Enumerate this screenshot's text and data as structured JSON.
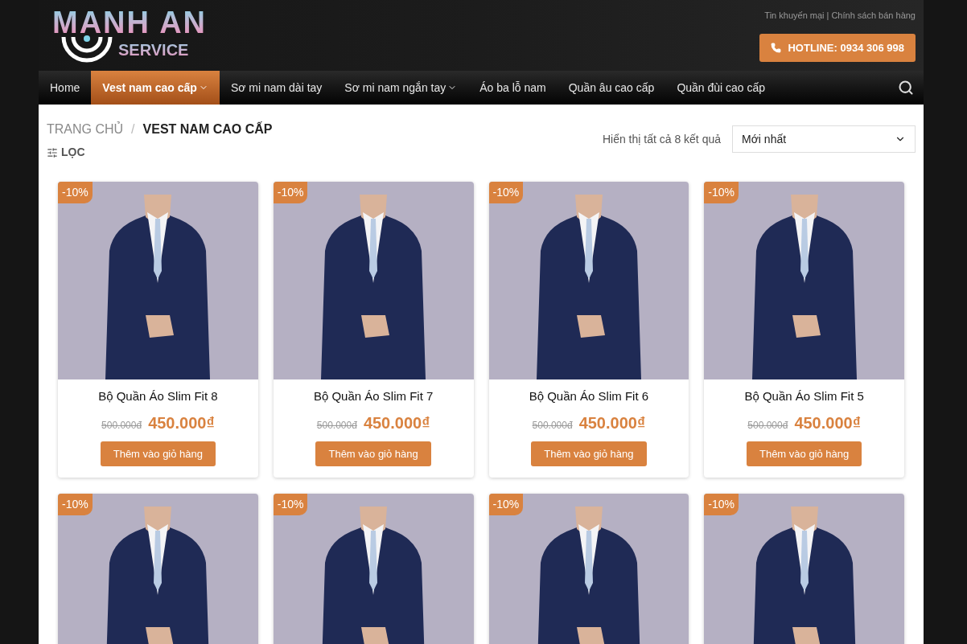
{
  "logo": {
    "title": "MANH AN",
    "subtitle": "SERVICE"
  },
  "top_links": [
    "Tin khuyến mại",
    "Chính sách bán hàng"
  ],
  "top_links_separator": "|",
  "hotline": "HOTLINE: 0934 306 998",
  "nav": [
    {
      "label": "Home",
      "selected": false,
      "dropdown": false
    },
    {
      "label": "Vest nam cao cấp",
      "selected": true,
      "dropdown": true
    },
    {
      "label": "Sơ mi nam dài tay",
      "selected": false,
      "dropdown": false
    },
    {
      "label": "Sơ mi nam ngắn tay",
      "selected": false,
      "dropdown": true
    },
    {
      "label": "Áo ba lỗ nam",
      "selected": false,
      "dropdown": false
    },
    {
      "label": "Quần âu cao cấp",
      "selected": false,
      "dropdown": false
    },
    {
      "label": "Quần đùi cao cấp",
      "selected": false,
      "dropdown": false
    }
  ],
  "breadcrumb": {
    "home": "TRANG CHỦ",
    "separator": "/",
    "current": "VEST NAM CAO CẤP"
  },
  "filter": "LỌC",
  "result_count": "Hiển thị tất cả 8 kết quả",
  "sort": {
    "value": "Mới nhất"
  },
  "products": [
    {
      "badge": "-10%",
      "name": "Bộ Quần Áo Slim Fit 8",
      "old_price": "500.000đ",
      "price": "450.000₫",
      "button": "Thêm vào giỏ hàng"
    },
    {
      "badge": "-10%",
      "name": "Bộ Quần Áo Slim Fit 7",
      "old_price": "500.000đ",
      "price": "450.000₫",
      "button": "Thêm vào giỏ hàng"
    },
    {
      "badge": "-10%",
      "name": "Bộ Quần Áo Slim Fit 6",
      "old_price": "500.000đ",
      "price": "450.000₫",
      "button": "Thêm vào giỏ hàng"
    },
    {
      "badge": "-10%",
      "name": "Bộ Quần Áo Slim Fit 5",
      "old_price": "500.000đ",
      "price": "450.000₫",
      "button": "Thêm vào giỏ hàng"
    },
    {
      "badge": "-10%"
    },
    {
      "badge": "-10%"
    },
    {
      "badge": "-10%"
    },
    {
      "badge": "-10%"
    }
  ]
}
